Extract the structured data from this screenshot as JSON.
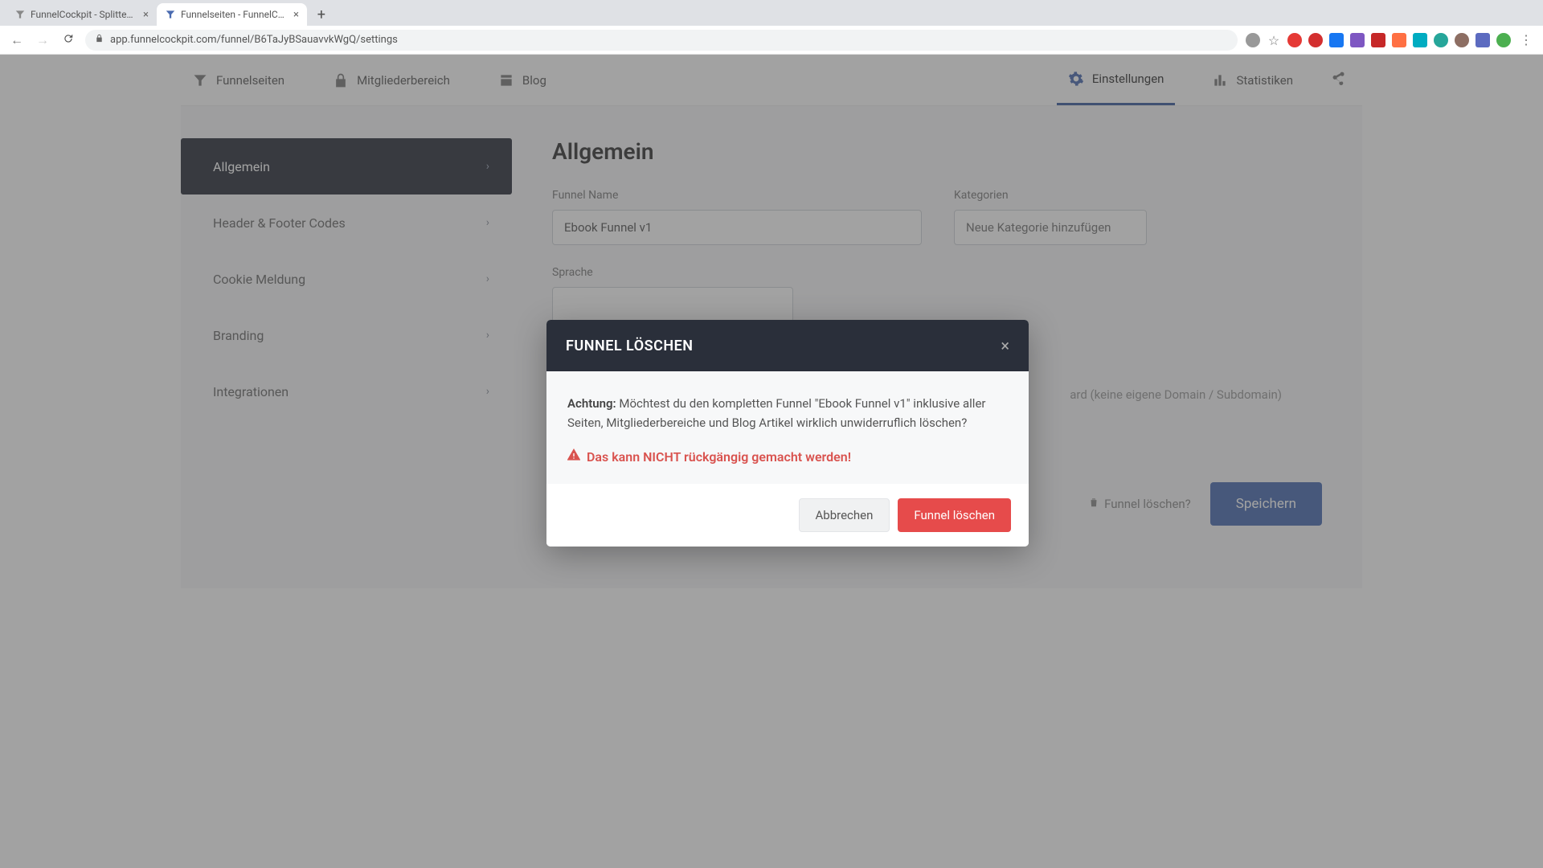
{
  "browser": {
    "tabs": [
      {
        "title": "FunnelCockpit - Splittests, Ma"
      },
      {
        "title": "Funnelseiten - FunnelCockpit"
      }
    ],
    "url": "app.funnelcockpit.com/funnel/B6TaJyBSauavvkWgQ/settings"
  },
  "nav": {
    "funnelseiten": "Funnelseiten",
    "mitgliederbereich": "Mitgliederbereich",
    "blog": "Blog",
    "einstellungen": "Einstellungen",
    "statistiken": "Statistiken"
  },
  "sidebar": {
    "items": [
      {
        "label": "Allgemein"
      },
      {
        "label": "Header & Footer Codes"
      },
      {
        "label": "Cookie Meldung"
      },
      {
        "label": "Branding"
      },
      {
        "label": "Integrationen"
      }
    ]
  },
  "content": {
    "title": "Allgemein",
    "funnel_name_label": "Funnel Name",
    "funnel_name_value": "Ebook Funnel v1",
    "kategorien_label": "Kategorien",
    "kategorien_placeholder": "Neue Kategorie hinzufügen",
    "sprache_label": "Sprache",
    "domain_hint_suffix": " (keine eigene Domain / Subdomain)",
    "domain_hint_word": "ard",
    "delete_link": "Funnel löschen?",
    "save": "Speichern"
  },
  "modal": {
    "title": "FUNNEL LÖSCHEN",
    "achtung": "Achtung:",
    "body": " Möchtest du den kompletten Funnel \"Ebook Funnel v1\" inklusive aller Seiten, Mitgliederbereiche und Blog Artikel wirklich unwiderruflich löschen?",
    "irreversible": "Das kann NICHT rückgängig gemacht werden!",
    "cancel": "Abbrechen",
    "confirm": "Funnel löschen"
  }
}
